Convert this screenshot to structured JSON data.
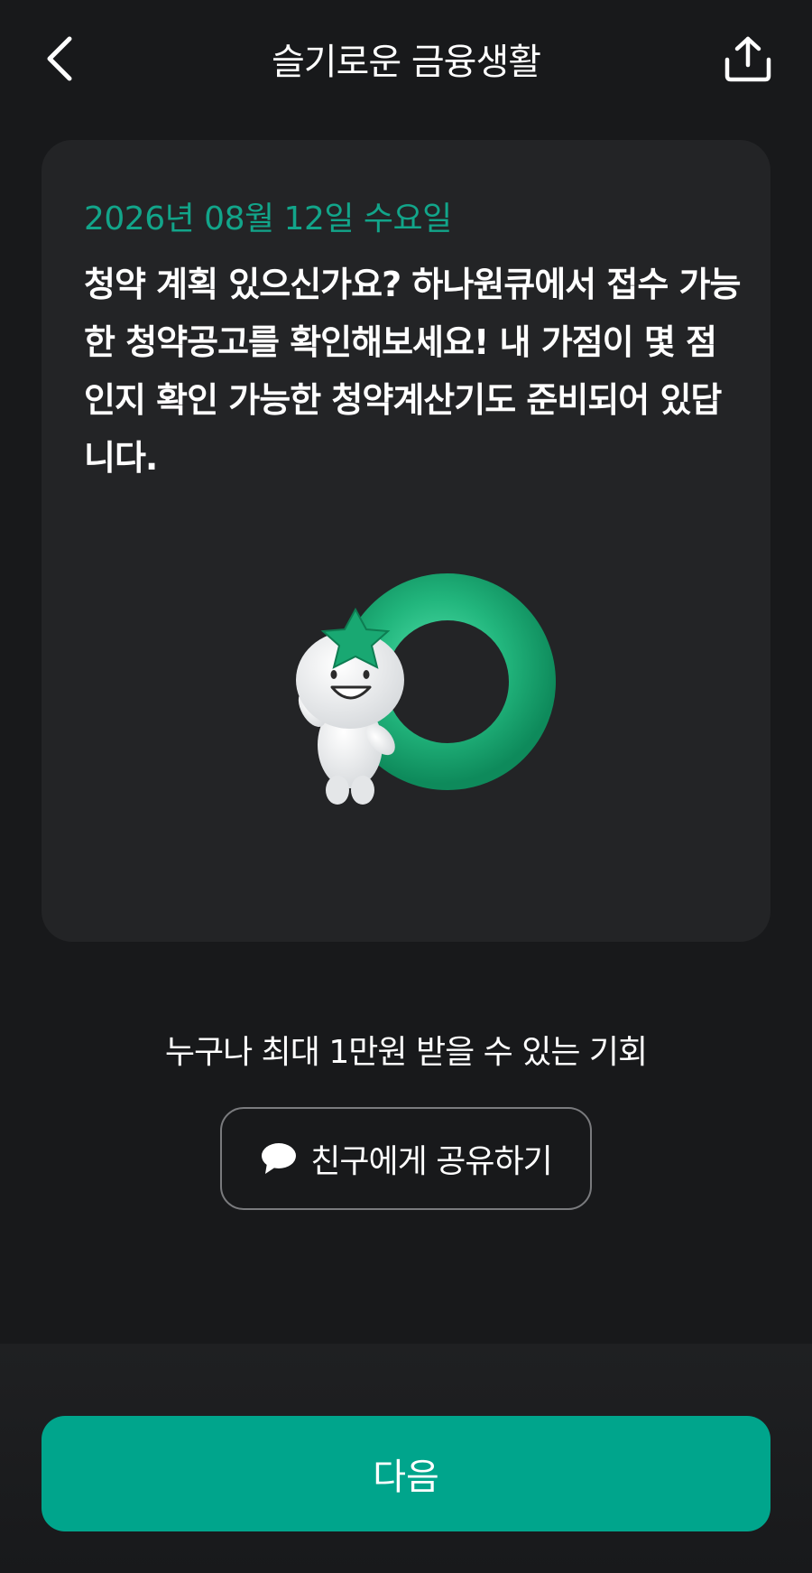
{
  "header": {
    "title": "슬기로운 금융생활",
    "back_icon": "chevron-left-icon",
    "share_icon": "share-upload-icon"
  },
  "card": {
    "date": "2026년 08월 12일 수요일",
    "message": "청약 계획 있으신가요? 하나원큐에서 접수 가능한 청약공고를 확인해보세요! 내 가점이 몇 점인지 확인 가능한 청약계산기도 준비되어 있답니다.",
    "illustration": "mascot-with-green-ring"
  },
  "offer": {
    "text": "누구나 최대 1만원 받을 수 있는 기회"
  },
  "share_friend": {
    "label": "친구에게 공유하기",
    "icon": "speech-bubble-icon"
  },
  "footer": {
    "next_label": "다음"
  },
  "colors": {
    "background": "#18191b",
    "card": "#232426",
    "accent": "#00a58c",
    "date_text": "#12a58a"
  }
}
